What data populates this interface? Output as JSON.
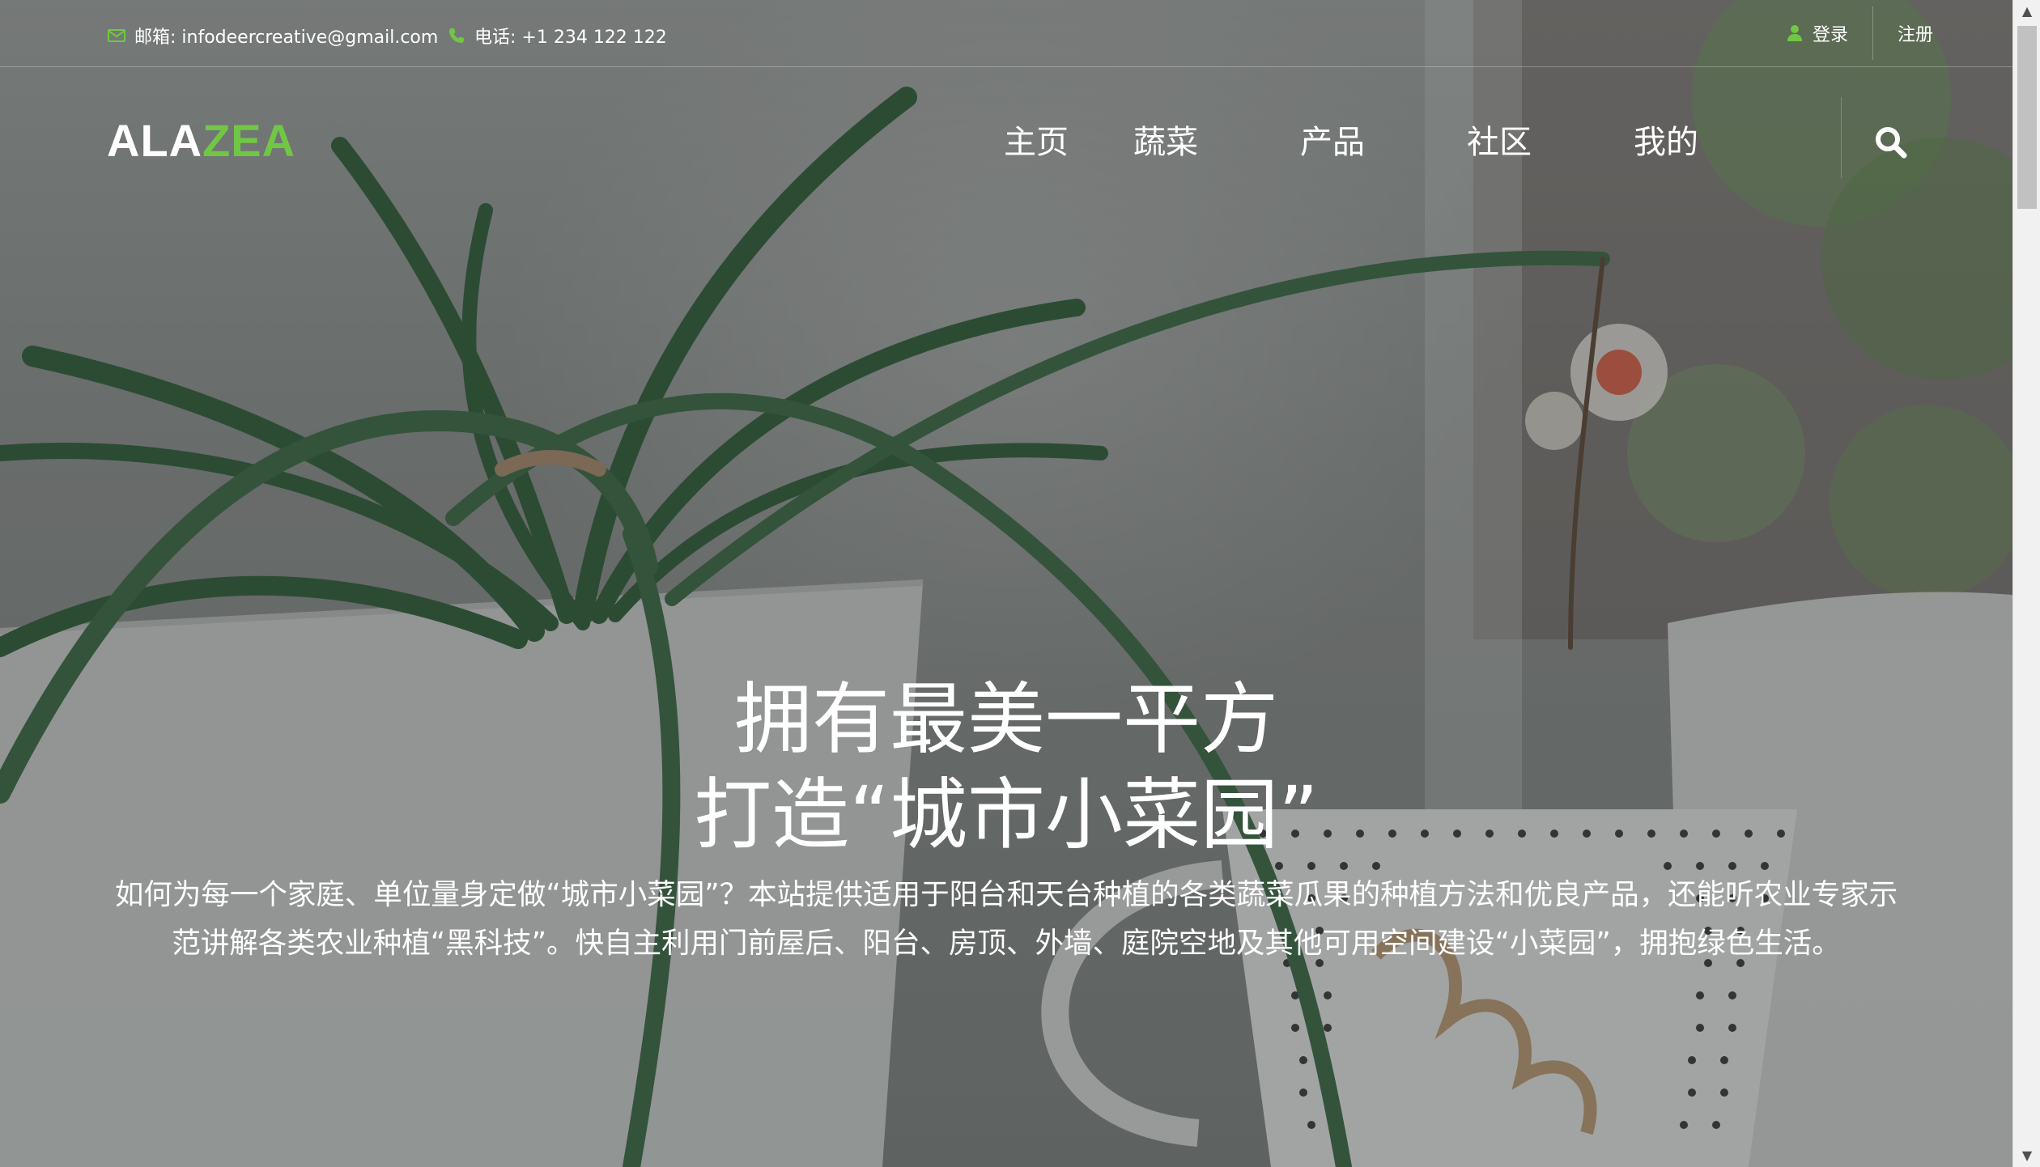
{
  "topbar": {
    "email_label": "邮箱: infodeercreative@gmail.com",
    "phone_label": "电话: +1 234 122 122",
    "login_label": "登录",
    "register_label": "注册"
  },
  "logo": {
    "part1": "ALA",
    "part2": "ZEA"
  },
  "nav": {
    "items": [
      {
        "label": "主页"
      },
      {
        "label": "蔬菜"
      },
      {
        "label": "产品"
      },
      {
        "label": "社区"
      },
      {
        "label": "我的"
      }
    ]
  },
  "hero": {
    "headline_line1": "拥有最美一平方",
    "headline_line2": "打造“城市小菜园”",
    "intro_line1": "如何为每一个家庭、单位量身定做“城市小菜园”？本站提供适用于阳台和天台种植的各类蔬菜瓜果的种植方法和优良产品，还能听农业专家示",
    "intro_line2": "范讲解各类农业种植“黑科技”。快自主利用门前屋后、阳台、房顶、外墙、庭院空地及其他可用空间建设“小菜园”，拥抱绿色生活。"
  },
  "icons": {
    "email": "envelope-icon",
    "phone": "phone-icon",
    "login": "user-icon",
    "search": "search-icon"
  },
  "colors": {
    "accent": "#70c745",
    "text": "#ffffff"
  }
}
